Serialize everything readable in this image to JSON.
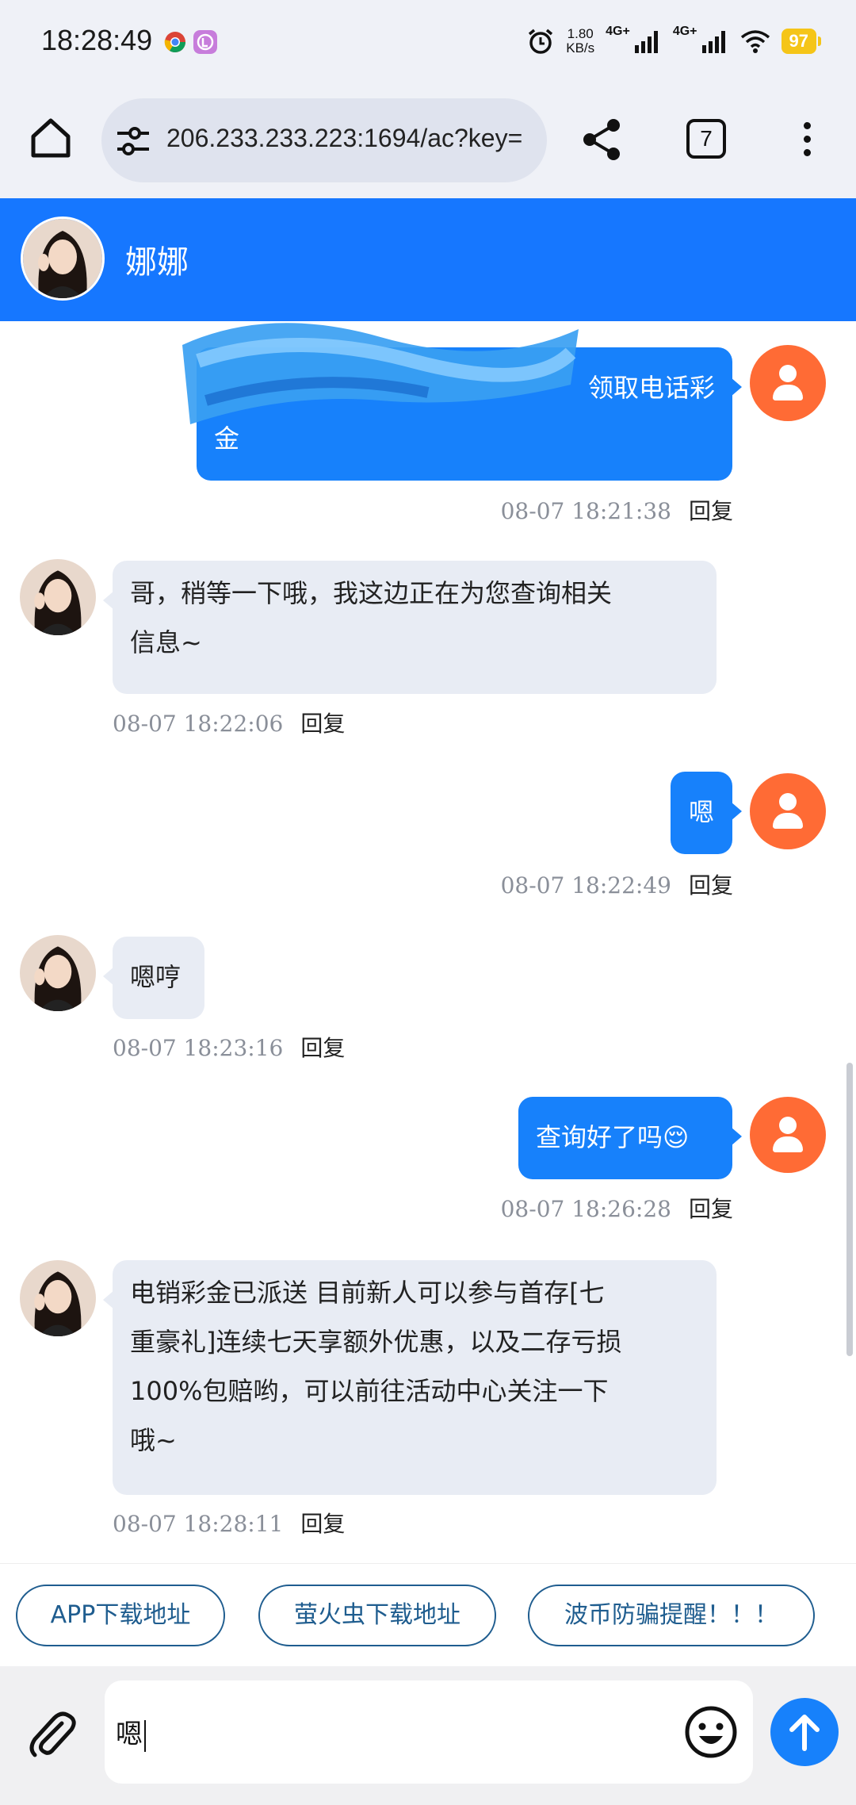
{
  "status_bar": {
    "time": "18:28:49",
    "net_speed_value": "1.80",
    "net_speed_unit": "KB/s",
    "network_1": "4G+",
    "network_2": "4G+",
    "battery": "97",
    "battery_color": "#f5c518"
  },
  "browser": {
    "url": "206.233.233.223:1694/ac?key=",
    "tab_count": "7"
  },
  "chat": {
    "contact_name": "娜娜",
    "header_color": "#1677ff",
    "reply_label": "回复",
    "messages": [
      {
        "sender": "me",
        "text_line1": "领取电话彩",
        "text_line2": "金",
        "time": "08-07 18:21:38"
      },
      {
        "sender": "her",
        "text_line1": "哥，稍等一下哦，我这边正在为您查询相关",
        "text_line2": "信息~",
        "time": "08-07 18:22:06"
      },
      {
        "sender": "me",
        "text": "嗯",
        "time": "08-07 18:22:49"
      },
      {
        "sender": "her",
        "text": "嗯哼",
        "time": "08-07 18:23:16"
      },
      {
        "sender": "me",
        "text": "查询好了吗😌",
        "time": "08-07 18:26:28"
      },
      {
        "sender": "her",
        "text_line1": "电销彩金已派送 目前新人可以参与首存[七",
        "text_line2": "重豪礼]连续七天享额外优惠，以及二存亏损",
        "text_line3": "100%包赔哟，可以前往活动中心关注一下",
        "text_line4": "哦~",
        "time": "08-07 18:28:11"
      }
    ]
  },
  "quick_replies": [
    "APP下载地址",
    "萤火虫下载地址",
    "波币防骗提醒！！！"
  ],
  "input": {
    "value": "嗯"
  },
  "icons": {
    "home": "home-icon",
    "site_info": "tune-icon",
    "share": "share-icon",
    "menu": "more-vert-icon",
    "attach": "paperclip-icon",
    "emoji": "emoji-icon",
    "send": "arrow-up-icon",
    "user": "person-icon"
  },
  "accent_color": "#1781fb",
  "user_avatar_color": "#ff6b35"
}
